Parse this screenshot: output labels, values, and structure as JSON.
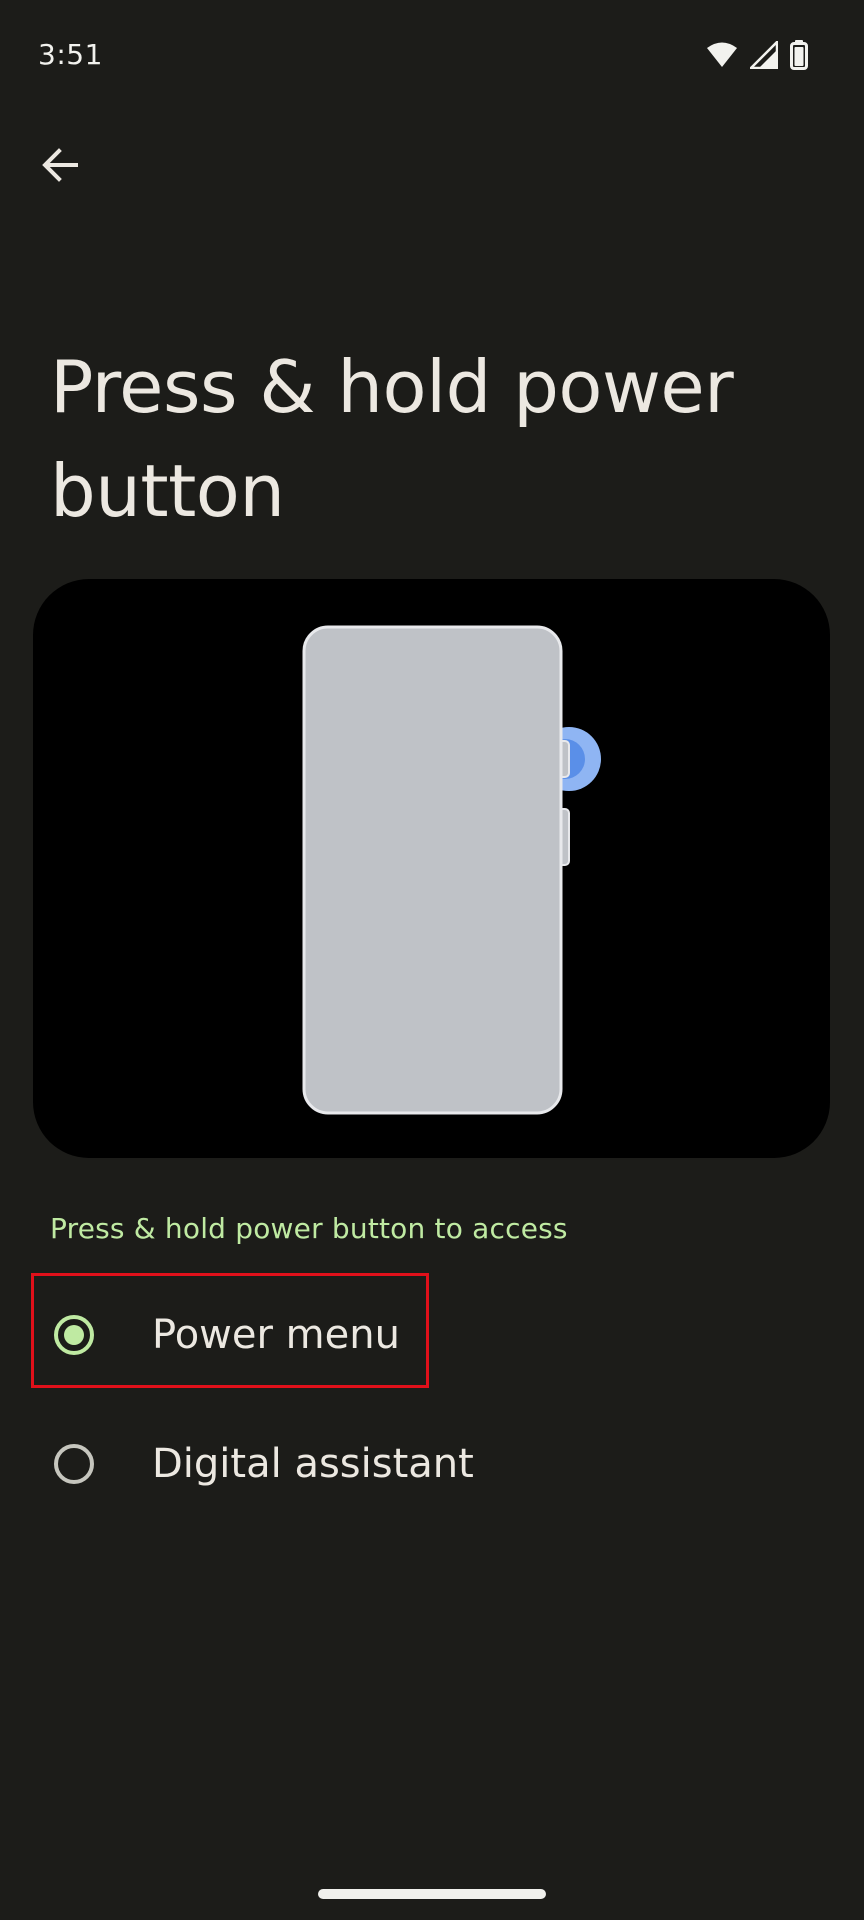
{
  "status_bar": {
    "time": "3:51",
    "icons": [
      "wifi-icon",
      "cell-signal-icon",
      "battery-icon"
    ]
  },
  "header": {
    "back_icon": "arrow-back-icon",
    "title": "Press & hold power button"
  },
  "illustration": {
    "description_icon": "phone-power-button-illustration",
    "colors": {
      "phone_body": "#bfc2c7",
      "press_indicator": "#5a8fe8",
      "press_halo": "#8fb5f3"
    }
  },
  "settings": {
    "section_header": "Press & hold power button to access",
    "options": [
      {
        "label": "Power menu",
        "selected": true
      },
      {
        "label": "Digital assistant",
        "selected": false
      }
    ]
  },
  "colors": {
    "background": "#1c1c19",
    "accent": "#bfeaa2",
    "highlight_box": "#e0101a"
  }
}
